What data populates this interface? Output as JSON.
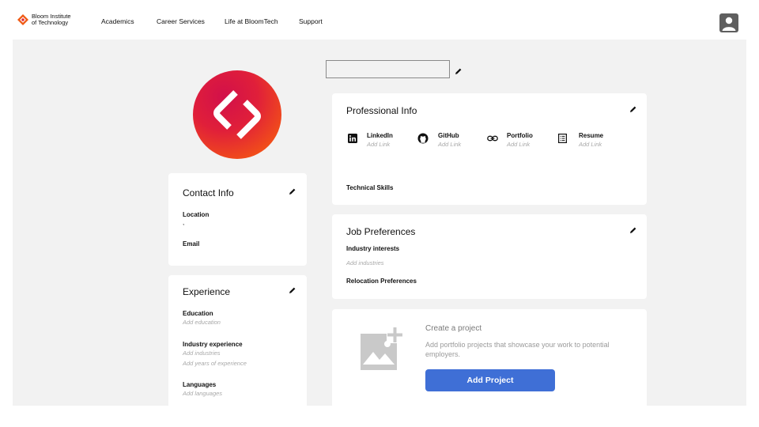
{
  "nav": {
    "logo_line1": "Bloom Institute",
    "logo_line2": "of Technology",
    "links": [
      "Academics",
      "Career Services",
      "Life at BloomTech",
      "Support"
    ]
  },
  "profile": {
    "name_value": ""
  },
  "contact": {
    "title": "Contact Info",
    "location_label": "Location",
    "location_value": ",",
    "email_label": "Email"
  },
  "experience": {
    "title": "Experience",
    "education_label": "Education",
    "education_hint": "Add education",
    "industry_label": "Industry experience",
    "industry_hint": "Add industries",
    "years_hint": "Add years of experience",
    "languages_label": "Languages",
    "languages_hint": "Add languages"
  },
  "professional": {
    "title": "Professional Info",
    "links": [
      {
        "name": "LinkedIn",
        "hint": "Add Link",
        "icon": "linkedin-icon"
      },
      {
        "name": "GitHub",
        "hint": "Add Link",
        "icon": "github-icon"
      },
      {
        "name": "Portfolio",
        "hint": "Add Link",
        "icon": "link-icon"
      },
      {
        "name": "Resume",
        "hint": "Add Link",
        "icon": "document-icon"
      }
    ],
    "skills_label": "Technical Skills"
  },
  "job": {
    "title": "Job Preferences",
    "industry_label": "Industry interests",
    "industry_hint": "Add industries",
    "relocation_label": "Relocation Preferences"
  },
  "project": {
    "title": "Create a project",
    "description": "Add portfolio projects that showcase your work to potential employers.",
    "button": "Add Project"
  },
  "colors": {
    "accent": "#3f6fd6",
    "brand_orange": "#f04a1c",
    "brand_red": "#d2104a",
    "background": "#f2f2f2"
  }
}
